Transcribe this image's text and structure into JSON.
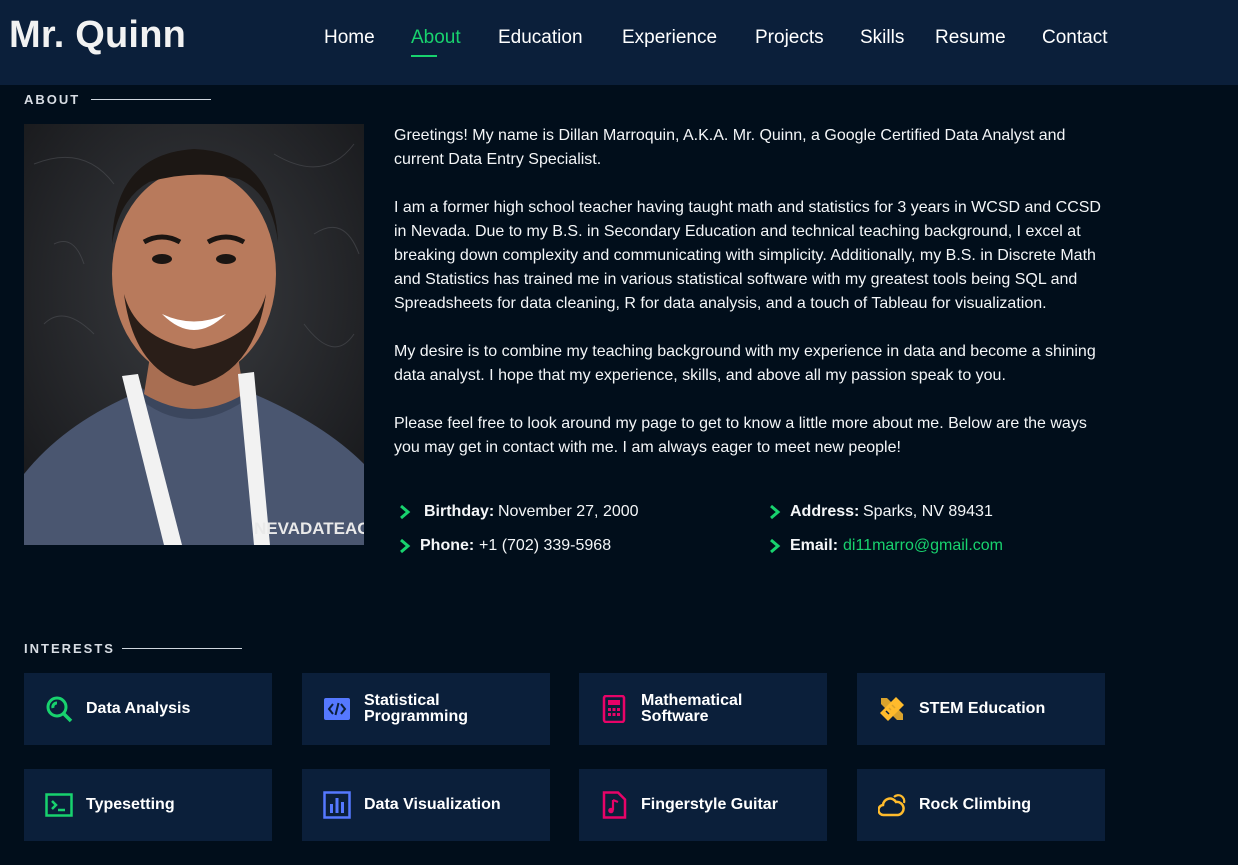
{
  "header": {
    "logo": "Mr. Quinn",
    "nav": [
      "Home",
      "About",
      "Education",
      "Experience",
      "Projects",
      "Skills",
      "Resume",
      "Contact"
    ],
    "active": "About"
  },
  "about": {
    "title": "ABOUT",
    "paragraphs": [
      "Greetings! My name is Dillan Marroquin, A.K.A. Mr. Quinn, a Google Certified Data Analyst and current Data Entry Specialist.",
      "I am a former high school teacher having taught math and statistics for 3 years in WCSD and CCSD in Nevada. Due to my B.S. in Secondary Education and technical teaching background, I excel at breaking down complexity and communicating with simplicity. Additionally, my B.S. in Discrete Math and Statistics has trained me in various statistical software with my greatest tools being SQL and Spreadsheets for data cleaning, R for data analysis, and a touch of Tableau for visualization.",
      "My desire is to combine my teaching background with my experience in data and become a shining data analyst. I hope that my experience, skills, and above all my passion speak to you.",
      "Please feel free to look around my page to get to know a little more about me. Below are the ways you may get in contact with me. I am always eager to meet new people!"
    ],
    "info": {
      "birthday_label": "Birthday:",
      "birthday": "November 27, 2000",
      "address_label": "Address:",
      "address": "Sparks, NV 89431",
      "phone_label": "Phone:",
      "phone": "+1 (702) 339-5968",
      "email_label": "Email:",
      "email": "di11marro@gmail.com"
    },
    "photo_badge_text": "NEVADATEACH"
  },
  "interests": {
    "title": "INTERESTS",
    "items": [
      {
        "line1": "Data Analysis",
        "line2": "",
        "icon": "search-icon",
        "color": "#18d26e"
      },
      {
        "line1": "Statistical",
        "line2": "Programming",
        "icon": "code-icon",
        "color": "#5578ff"
      },
      {
        "line1": "Mathematical",
        "line2": "Software",
        "icon": "calculator-icon",
        "color": "#e80368"
      },
      {
        "line1": "STEM Education",
        "line2": "",
        "icon": "ruler-pencil-icon",
        "color": "#ffbb2c"
      },
      {
        "line1": "Typesetting",
        "line2": "",
        "icon": "terminal-icon",
        "color": "#18d26e"
      },
      {
        "line1": "Data Visualization",
        "line2": "",
        "icon": "bar-chart-icon",
        "color": "#5578ff"
      },
      {
        "line1": "Fingerstyle Guitar",
        "line2": "",
        "icon": "music-file-icon",
        "color": "#e80368"
      },
      {
        "line1": "Rock Climbing",
        "line2": "",
        "icon": "cloud-sun-icon",
        "color": "#ffbb2c"
      }
    ]
  }
}
